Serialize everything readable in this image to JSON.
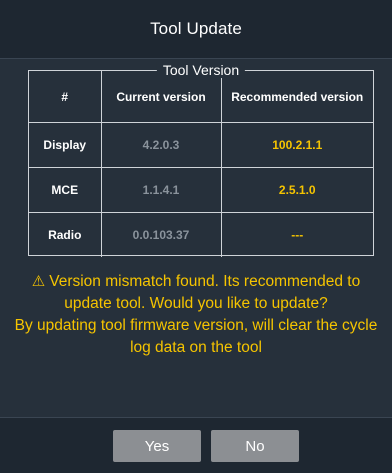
{
  "dialog": {
    "title": "Tool Update"
  },
  "version_table": {
    "legend": "Tool Version",
    "headers": [
      "#",
      "Current version",
      "Recommended version"
    ],
    "rows": [
      {
        "name": "Display",
        "current": "4.2.0.3",
        "recommended": "100.2.1.1"
      },
      {
        "name": "MCE",
        "current": "1.1.4.1",
        "recommended": "2.5.1.0"
      },
      {
        "name": "Radio",
        "current": "0.0.103.37",
        "recommended": "---"
      }
    ]
  },
  "message": {
    "icon": "warning-icon",
    "line1": "Version mismatch found. Its recommended to update tool. Would you like to update?",
    "line2": "By updating tool firmware version, will clear the cycle log data on the tool"
  },
  "buttons": {
    "yes_label": "Yes",
    "no_label": "No"
  },
  "colors": {
    "background": "#26303b",
    "header_footer": "#1e2731",
    "accent_yellow": "#f5c400",
    "muted_text": "#8a939c",
    "button": "#8c8f93"
  }
}
